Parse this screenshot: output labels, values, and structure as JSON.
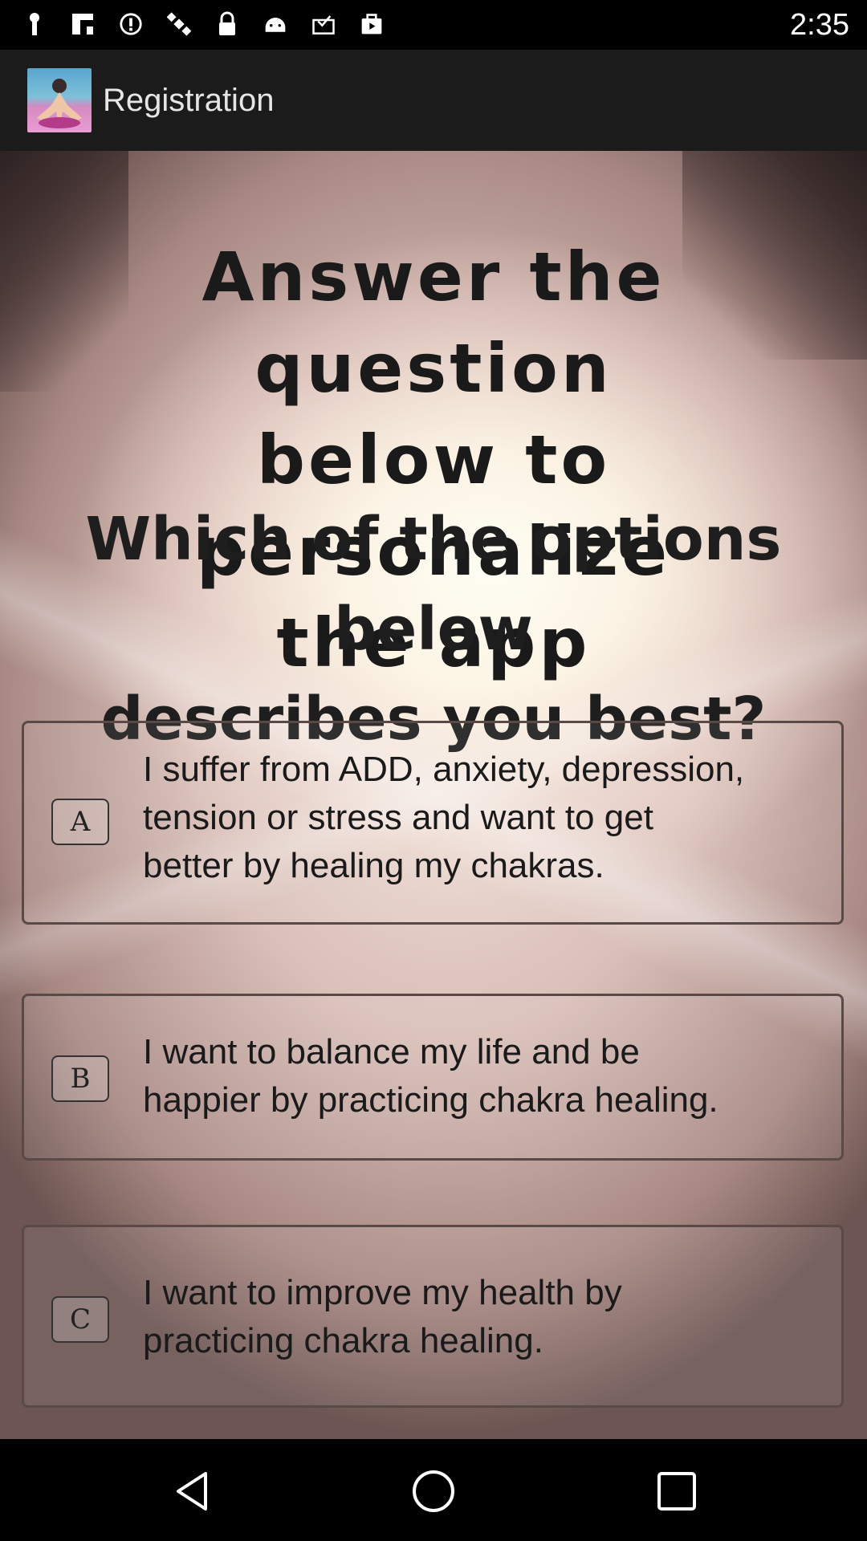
{
  "status_bar": {
    "time": "2:35",
    "icons": [
      "notification-icon",
      "flipboard-icon",
      "alert-icon",
      "satellite-icon",
      "lock-icon",
      "android-icon",
      "inbox-icon",
      "bag-icon"
    ]
  },
  "app_bar": {
    "title": "Registration",
    "logo": "app-logo"
  },
  "headline": [
    "Answer the question",
    "below to personalize",
    "the app"
  ],
  "question": [
    "Which of the options below",
    "describes you best?"
  ],
  "options": [
    {
      "letter": "A",
      "lines": [
        "I suffer from ADD, anxiety, depression,",
        "tension or stress and want to get",
        "better by healing my chakras."
      ]
    },
    {
      "letter": "B",
      "lines": [
        "I want to balance my life and be",
        "happier by practicing chakra healing."
      ]
    },
    {
      "letter": "C",
      "lines": [
        "I want to improve my health by",
        "practicing chakra healing."
      ]
    }
  ],
  "nav_bar": {
    "icons": [
      "back-icon",
      "home-icon",
      "recents-icon"
    ]
  }
}
